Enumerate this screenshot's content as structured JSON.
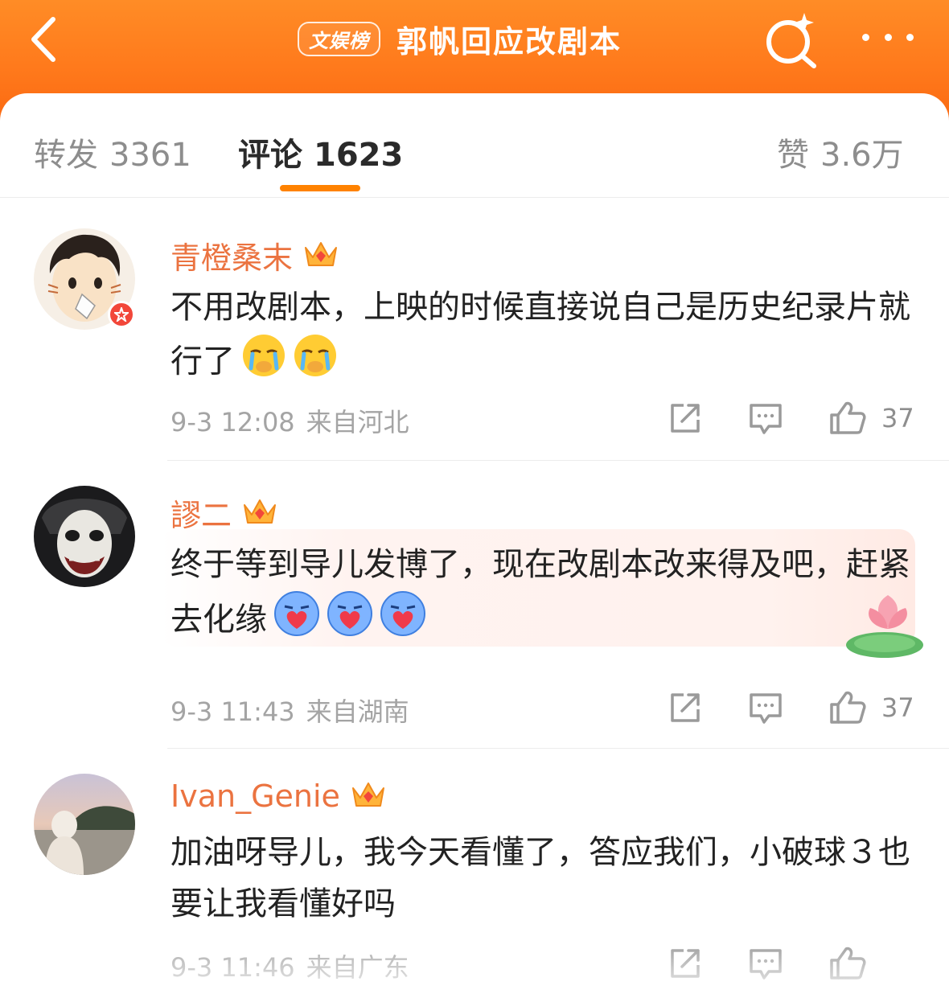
{
  "header": {
    "tag": "文娱榜",
    "title": "郭帆回应改剧本",
    "back_icon": "chevron-left-icon",
    "search_icon": "search-sparkle-icon",
    "more_icon": "more-horizontal-icon"
  },
  "tabs": {
    "repost": {
      "label": "转发",
      "count": "3361"
    },
    "comment": {
      "label": "评论",
      "count": "1623"
    },
    "like": {
      "label": "赞",
      "count": "3.6万"
    },
    "active": "comment",
    "accent_color": "#ff8200"
  },
  "colors": {
    "header_orange": "#ff7a1c",
    "username_orange": "#eb7340",
    "meta_gray": "#a4a4a4"
  },
  "comments": [
    {
      "username": "青橙桑末",
      "badge": "crown-vip-icon",
      "verified": true,
      "text": "不用改剧本，上映的时候直接说自己是历史纪录片就行了",
      "emoji": [
        "crying-face-emoji",
        "crying-face-emoji"
      ],
      "time": "9-3 12:08",
      "location": "来自河北",
      "likes": "37"
    },
    {
      "username": "謬二",
      "badge": "crown-vip-icon",
      "verified": false,
      "text": "终于等到导儿发博了，现在改剧本改来得及吧，赶紧去化缘",
      "emoji": [
        "heart-hug-emoji",
        "heart-hug-emoji",
        "heart-hug-emoji"
      ],
      "time": "9-3 11:43",
      "location": "来自湖南",
      "likes": "37"
    },
    {
      "username": "Ivan_Genie",
      "badge": "crown-vip-icon",
      "verified": false,
      "text": "加油呀导儿，我今天看懂了，答应我们，小破球３也要让我看懂好吗",
      "emoji": [],
      "time": "9-3 11:46",
      "location": "来自广东",
      "likes": ""
    }
  ]
}
